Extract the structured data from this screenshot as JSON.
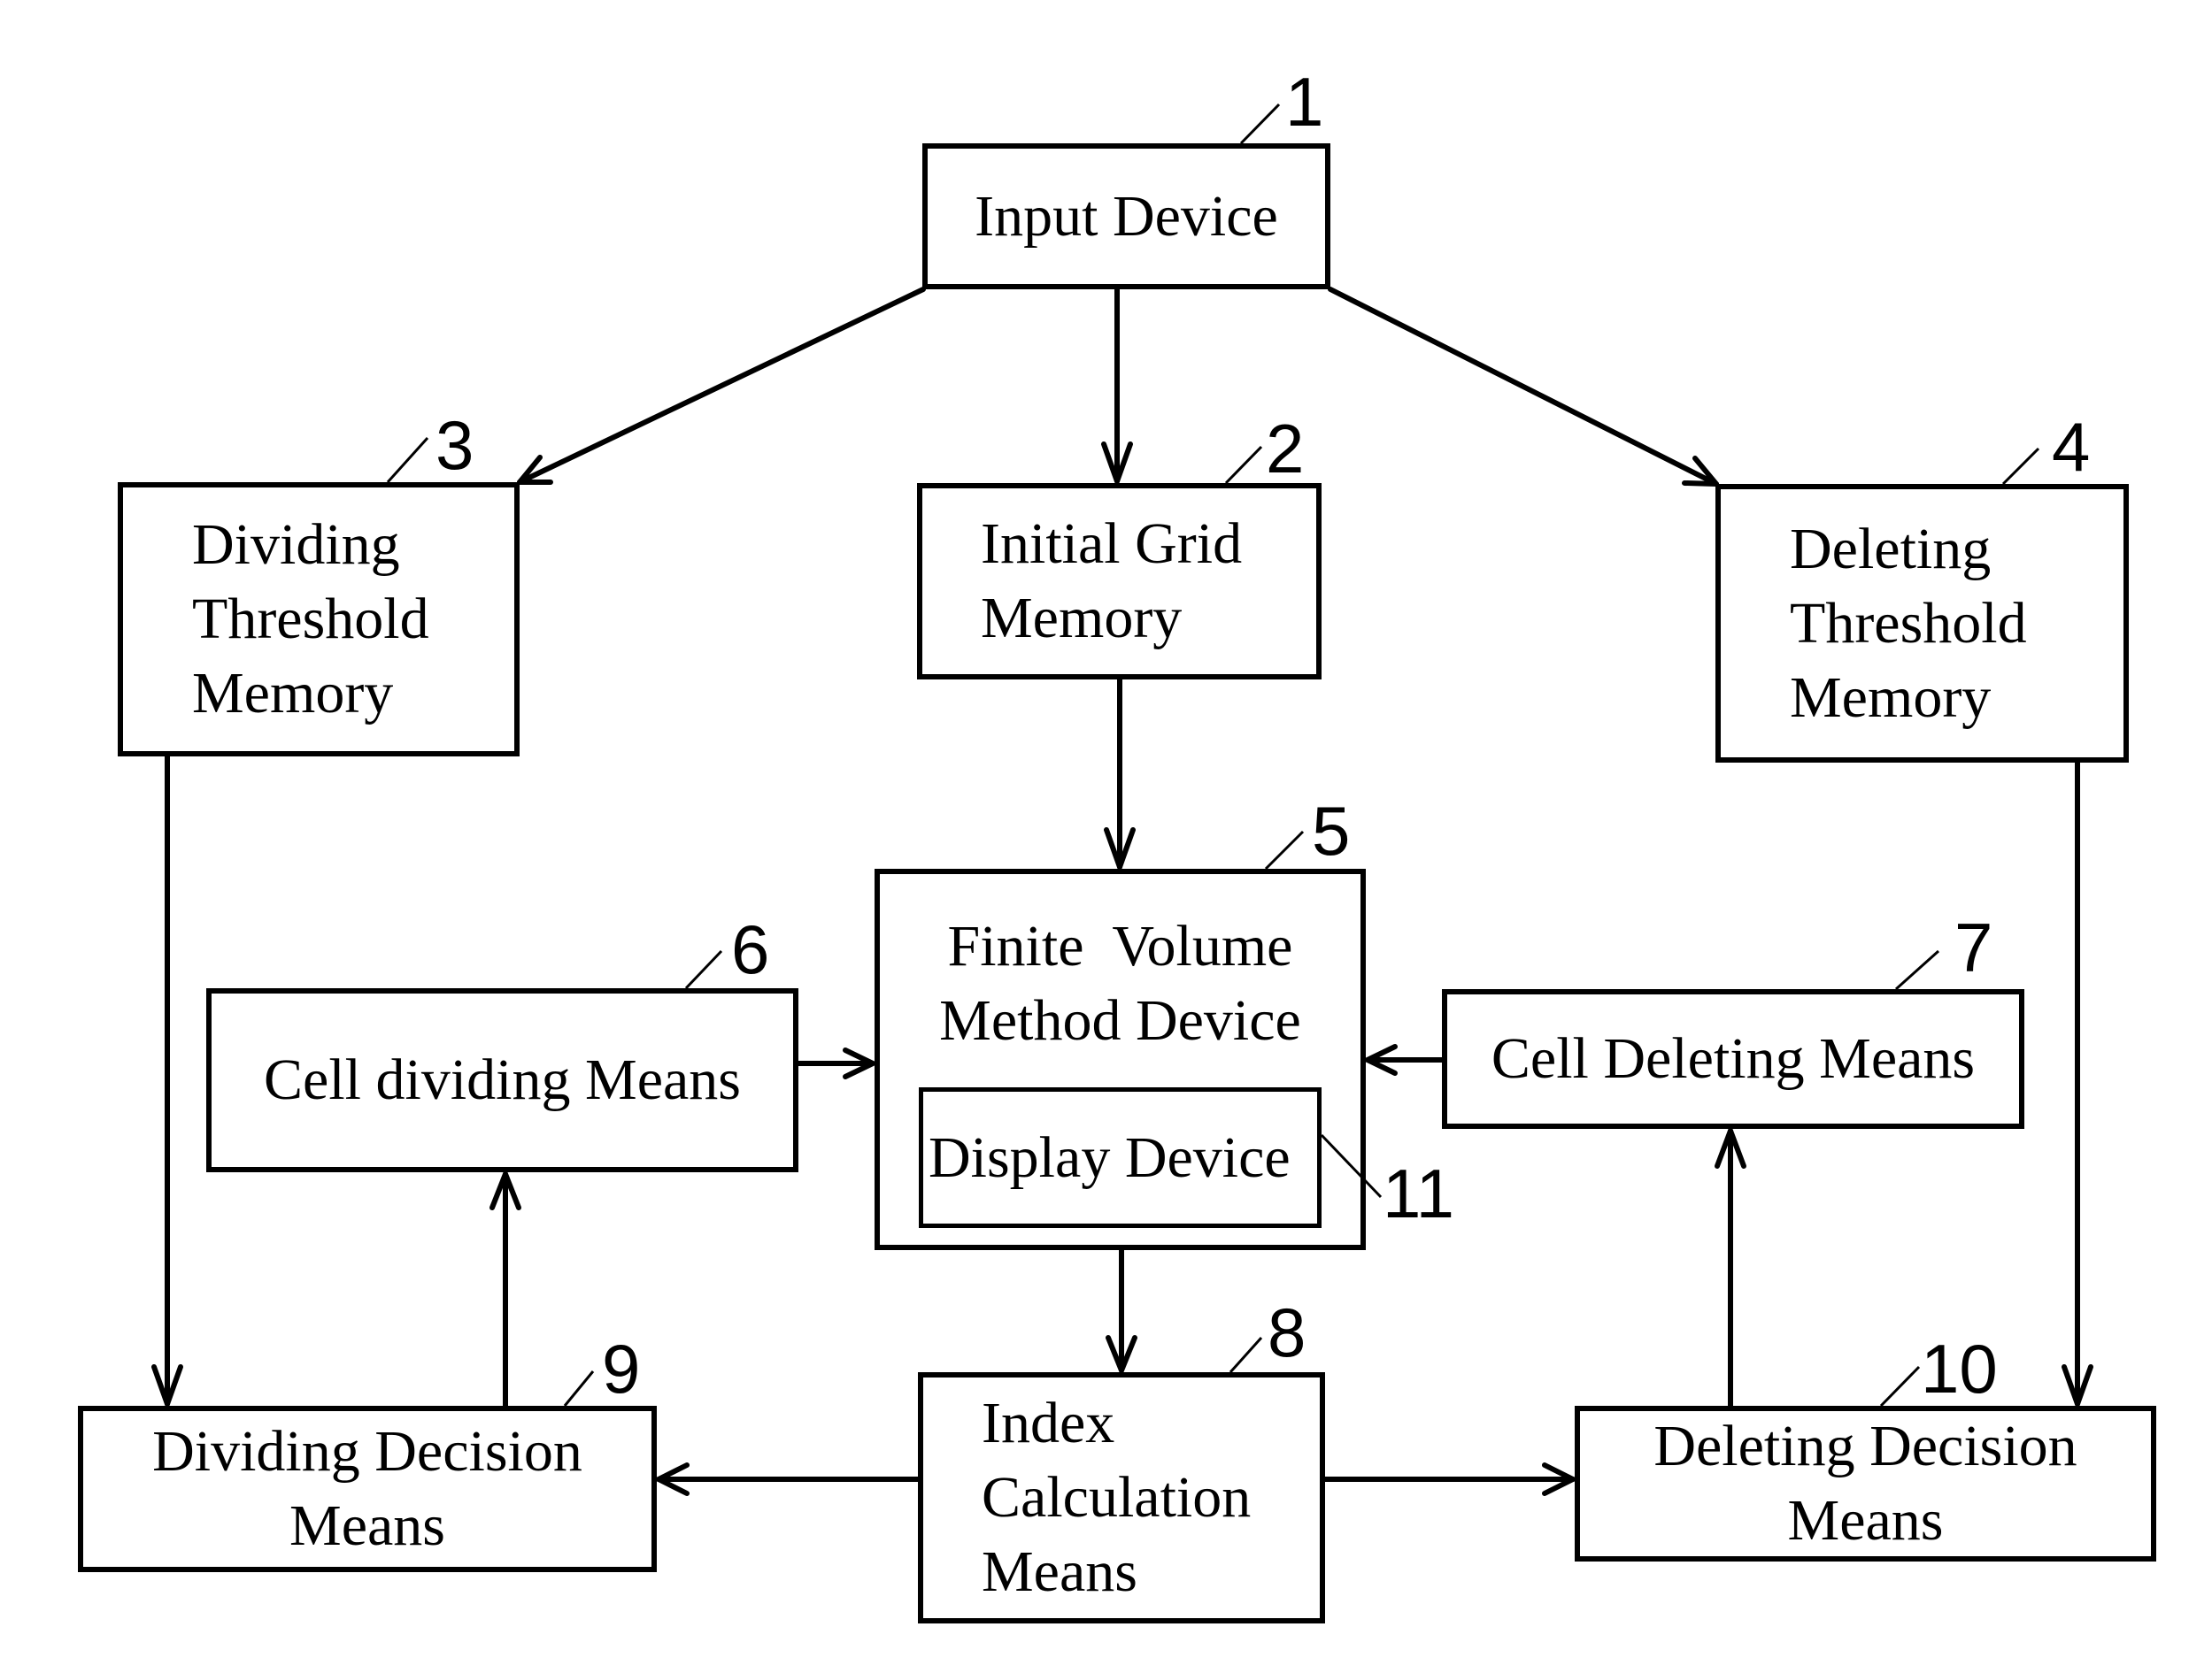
{
  "diagram": {
    "type": "block-diagram",
    "blocks": {
      "input_device": {
        "ref": "1",
        "lines": [
          "Input Device"
        ]
      },
      "initial_grid_memory": {
        "ref": "2",
        "lines": [
          "Initial Grid",
          "Memory"
        ]
      },
      "dividing_threshold_memory": {
        "ref": "3",
        "lines": [
          "Dividing",
          "Threshold",
          "Memory"
        ]
      },
      "deleting_threshold_memory": {
        "ref": "4",
        "lines": [
          "Deleting",
          "Threshold",
          "Memory"
        ]
      },
      "finite_volume_method_device": {
        "ref": "5",
        "lines": [
          "Finite  Volume",
          "Method Device"
        ]
      },
      "cell_dividing_means": {
        "ref": "6",
        "lines": [
          "Cell dividing Means"
        ]
      },
      "cell_deleting_means": {
        "ref": "7",
        "lines": [
          "Cell Deleting Means"
        ]
      },
      "index_calculation_means": {
        "ref": "8",
        "lines": [
          "Index",
          "Calculation",
          "Means"
        ]
      },
      "dividing_decision_means": {
        "ref": "9",
        "lines": [
          "Dividing Decision",
          "Means"
        ]
      },
      "deleting_decision_means": {
        "ref": "10",
        "lines": [
          "Deleting Decision",
          "Means"
        ]
      },
      "display_device": {
        "ref": "11",
        "lines": [
          "Display Device"
        ]
      }
    },
    "connections": [
      {
        "from": "input_device",
        "to": "initial_grid_memory"
      },
      {
        "from": "input_device",
        "to": "dividing_threshold_memory"
      },
      {
        "from": "input_device",
        "to": "deleting_threshold_memory"
      },
      {
        "from": "initial_grid_memory",
        "to": "finite_volume_method_device"
      },
      {
        "from": "dividing_threshold_memory",
        "to": "dividing_decision_means"
      },
      {
        "from": "deleting_threshold_memory",
        "to": "deleting_decision_means"
      },
      {
        "from": "cell_dividing_means",
        "to": "finite_volume_method_device"
      },
      {
        "from": "cell_deleting_means",
        "to": "finite_volume_method_device"
      },
      {
        "from": "finite_volume_method_device",
        "to": "index_calculation_means"
      },
      {
        "from": "index_calculation_means",
        "to": "dividing_decision_means"
      },
      {
        "from": "index_calculation_means",
        "to": "deleting_decision_means"
      },
      {
        "from": "dividing_decision_means",
        "to": "cell_dividing_means"
      },
      {
        "from": "deleting_decision_means",
        "to": "cell_deleting_means"
      }
    ],
    "colors": {
      "stroke": "#000000",
      "background": "#ffffff"
    }
  }
}
